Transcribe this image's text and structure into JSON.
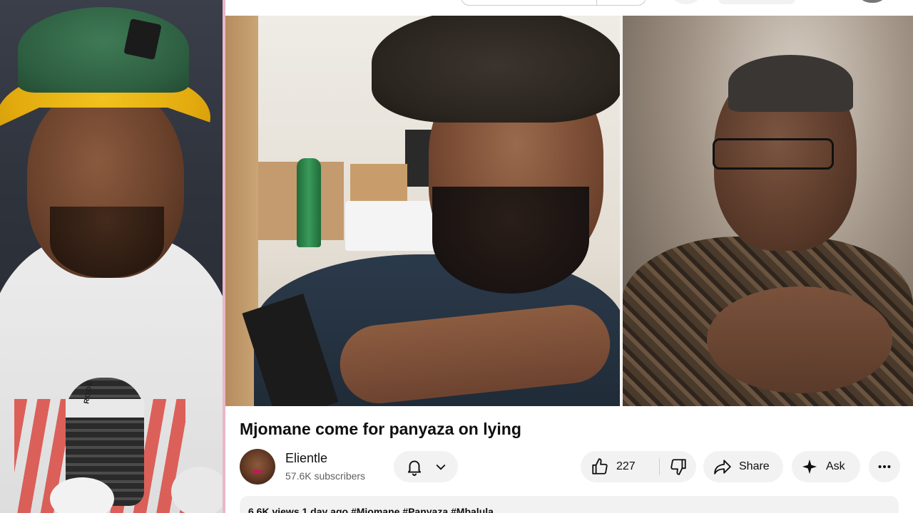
{
  "video": {
    "title": "Mjomane come for panyaza on lying"
  },
  "channel": {
    "name": "Elientle",
    "subscribers": "57.6K subscribers"
  },
  "actions": {
    "likes": "227",
    "share_label": "Share",
    "ask_label": "Ask"
  },
  "webcam": {
    "mic_brand": "RODE"
  },
  "description": {
    "preview": "6.6K views  1 day ago  #Mjomane  #Panyaza  #Mbalula..."
  },
  "icons": {
    "bell": "bell-icon",
    "chevron": "chevron-down-icon",
    "like": "thumbs-up-icon",
    "dislike": "thumbs-down-icon",
    "share": "share-arrow-icon",
    "ask": "sparkle-icon",
    "more": "more-horizontal-icon"
  }
}
